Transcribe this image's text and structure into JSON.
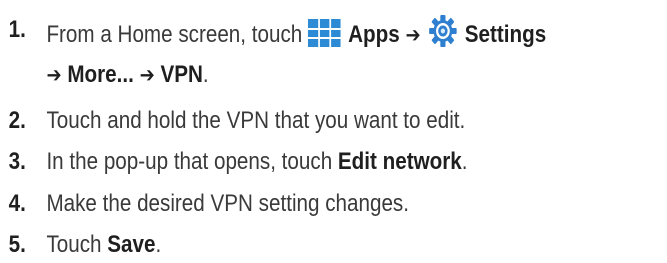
{
  "steps": [
    {
      "number": "1.",
      "line1": {
        "text_a": "From a Home screen, touch",
        "apps_icon": "apps-grid-icon",
        "apps_label": "Apps",
        "arrow": "➔",
        "settings_icon": "settings-gear-icon",
        "settings_label": "Settings"
      },
      "line2": {
        "arrow1": "➔",
        "more_label": "More...",
        "arrow2": "➔",
        "vpn_label": "VPN",
        "period": "."
      }
    },
    {
      "number": "2.",
      "text": "Touch and hold the VPN that you want to edit."
    },
    {
      "number": "3.",
      "text_a": "In the pop-up that opens, touch",
      "bold": "Edit network",
      "text_b": "."
    },
    {
      "number": "4.",
      "text": "Make the desired VPN setting changes."
    },
    {
      "number": "5.",
      "text_a": "Touch",
      "bold": "Save",
      "text_b": "."
    }
  ],
  "colors": {
    "apps_icon": "#2d8bd6",
    "settings_icon": "#2f7fd0",
    "text": "#3a3a3a"
  }
}
